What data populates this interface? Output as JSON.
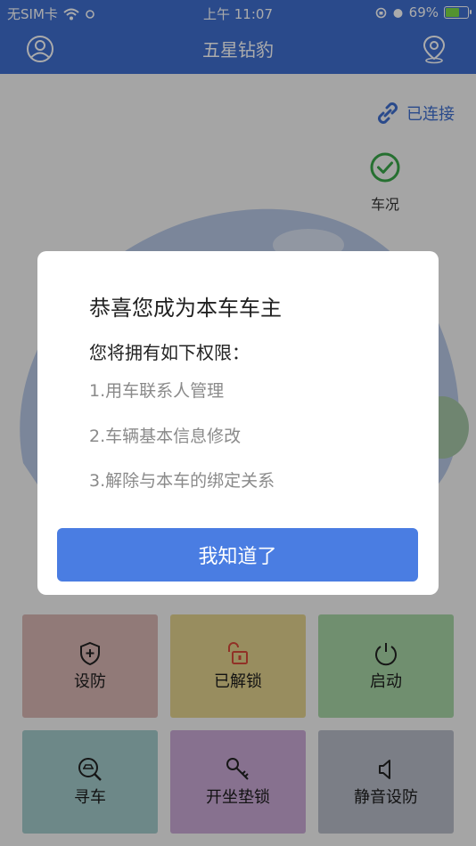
{
  "status": {
    "carrier": "无SIM卡",
    "time": "上午 11:07",
    "battery": "69%",
    "battery_level": 0.69
  },
  "nav": {
    "title": "五星钻豹",
    "left_icon": "user-icon",
    "right_icon": "location-pin-icon"
  },
  "connection": {
    "label": "已连接",
    "icon": "link-icon"
  },
  "condition": {
    "label": "车况",
    "icon": "check-circle-icon"
  },
  "tiles": [
    {
      "label": "设防",
      "icon": "shield-plus-icon",
      "color": "#d8b7b4"
    },
    {
      "label": "已解锁",
      "icon": "unlock-icon",
      "color": "#e3d38e"
    },
    {
      "label": "启动",
      "icon": "power-icon",
      "color": "#a8d6a6"
    },
    {
      "label": "寻车",
      "icon": "car-search-icon",
      "color": "#a3cbcb"
    },
    {
      "label": "开坐垫锁",
      "icon": "key-icon",
      "color": "#c9a9d6"
    },
    {
      "label": "静音设防",
      "icon": "speaker-mute-icon",
      "color": "#b8bcc8"
    }
  ],
  "modal": {
    "title": "恭喜您成为本车车主",
    "subtitle": "您将拥有如下权限：",
    "permissions": [
      "1.用车联系人管理",
      "2.车辆基本信息修改",
      "3.解除与本车的绑定关系"
    ],
    "button": "我知道了"
  },
  "colors": {
    "nav_bg": "#3f6fd0",
    "accent_green": "#3aa84a",
    "button_bg": "#4a7de2"
  }
}
